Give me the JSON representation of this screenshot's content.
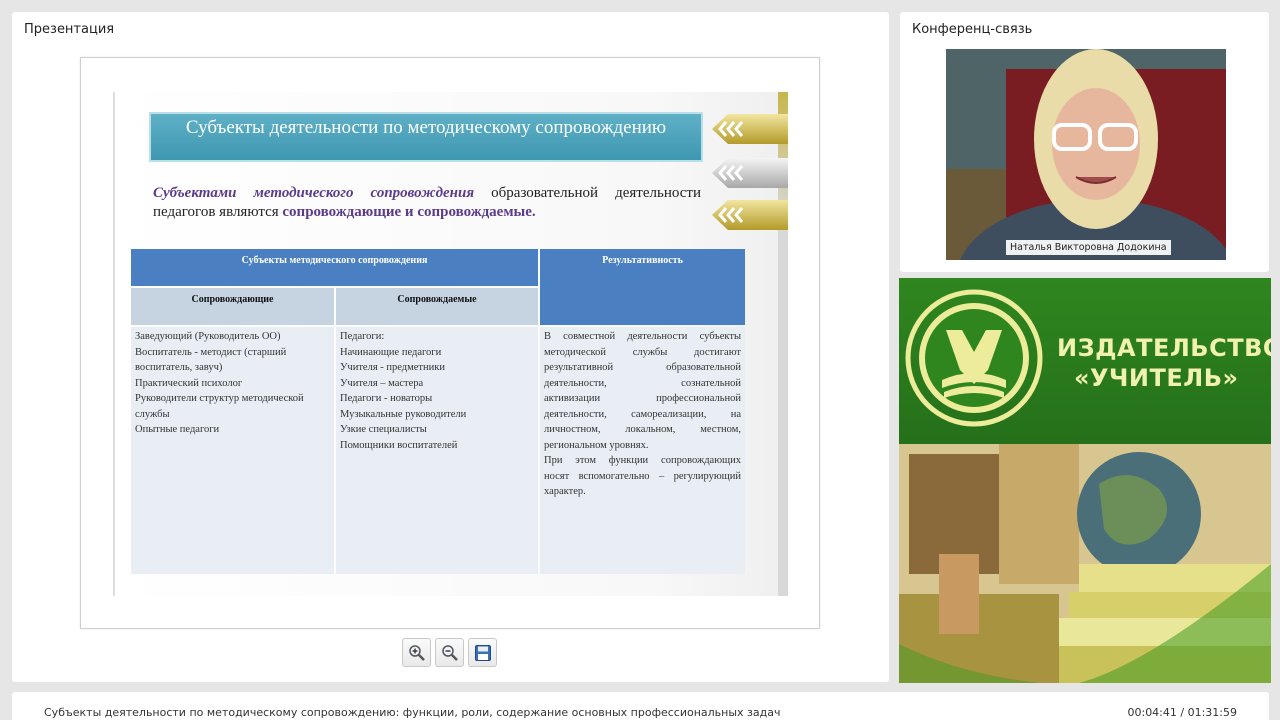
{
  "presentation": {
    "title": "Презентация"
  },
  "slide": {
    "heading": "Субъекты деятельности по методическому сопровождению",
    "lead": {
      "part1": "Субъектами методического сопровождения",
      "part2": " образовательной деятельности педагогов являются ",
      "part3": "сопровождающие и сопровождаемые."
    },
    "table": {
      "group_header": "Субъекты методического сопровождения",
      "result_header": "Результативность",
      "col1_header": "Сопровождающие",
      "col2_header": "Сопровождаемые",
      "col1": [
        " Заведующий (Руководитель ОО)",
        "Воспитатель -  методист (старший",
        "воспитатель, завуч)",
        "Практический психолог",
        "Руководители структур методической",
        "службы",
        "Опытные педагоги"
      ],
      "col2": [
        "Педагоги:",
        "Начинающие  педагоги",
        "Учителя - предметники",
        " Учителя – мастера",
        " Педагоги - новаторы",
        "Музыкальные руководители",
        "Узкие специалисты",
        "Помощники воспитателей"
      ],
      "col3_para1": [
        "В совместной деятельности субъекты",
        "методической службы достигают",
        "результативной образовательной",
        "деятельности, сознательной",
        "активизации профессиональной",
        "деятельности, самореализации, на",
        "личностном, локальном, местном,"
      ],
      "col3_para1_last": "региональном уровнях.",
      "col3_para2": [
        "При этом функции сопровождающих",
        "носят вспомогательно – регулирующий"
      ],
      "col3_para2_last": "характер."
    }
  },
  "toolbar": {
    "zoom_in_icon": "zoom-in-icon",
    "zoom_out_icon": "zoom-out-icon",
    "save_icon": "floppy-disk-icon"
  },
  "conference": {
    "title": "Конференц-связь",
    "speaker_name": "Наталья Викторовна Додокина"
  },
  "banner": {
    "line1": "ИЗДАТЕЛЬСТВО",
    "line2": "«УЧИТЕЛЬ»"
  },
  "footer": {
    "lecture_title": "Субъекты деятельности по методическому сопровождению: функции, роли, содержание основных профессиональных задач",
    "time": "00:04:41 / 01:31:59"
  },
  "colors": {
    "banner_green": "#2f861f",
    "table_blue": "#4a7fc2",
    "title_teal": "#4aa3bb",
    "accent_purple": "#5a3b8c"
  }
}
